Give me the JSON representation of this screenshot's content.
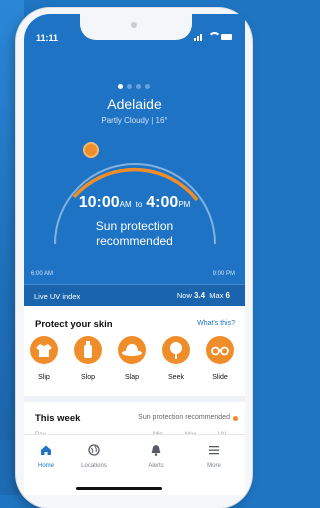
{
  "status": {
    "time": "11:11"
  },
  "location": {
    "city": "Adelaide",
    "weather": "Partly Cloudy | 16°"
  },
  "pager": {
    "count": 4,
    "active": 0
  },
  "protection": {
    "start_time": "10:00",
    "start_suffix": "AM",
    "connector": "to",
    "end_time": "4:00",
    "end_suffix": "PM",
    "message": "Sun protection recommended",
    "day_start": "6:00 AM",
    "day_end": "9:00 PM"
  },
  "uv": {
    "label": "Live UV index",
    "now_label": "Now",
    "now_value": "3.4",
    "max_label": "Max",
    "max_value": "6"
  },
  "protect": {
    "title": "Protect your skin",
    "link": "What's this?",
    "items": [
      {
        "label": "Slip",
        "icon": "shirt-icon"
      },
      {
        "label": "Slop",
        "icon": "sunscreen-icon"
      },
      {
        "label": "Slap",
        "icon": "hat-icon"
      },
      {
        "label": "Seek",
        "icon": "shade-tree-icon"
      },
      {
        "label": "Slide",
        "icon": "sunglasses-icon"
      }
    ]
  },
  "week": {
    "title": "This week",
    "status": "Sun protection recommended",
    "columns": [
      "Day",
      "Min",
      "Max",
      "UV"
    ]
  },
  "tabs": [
    {
      "label": "Home",
      "icon": "home-icon",
      "active": true
    },
    {
      "label": "Locations",
      "icon": "globe-icon",
      "active": false
    },
    {
      "label": "Alerts",
      "icon": "bell-icon",
      "active": false
    },
    {
      "label": "More",
      "icon": "menu-icon",
      "active": false
    }
  ],
  "colors": {
    "hero": "#1e73c5",
    "accent": "#f08d2b",
    "link": "#1e73c5"
  }
}
